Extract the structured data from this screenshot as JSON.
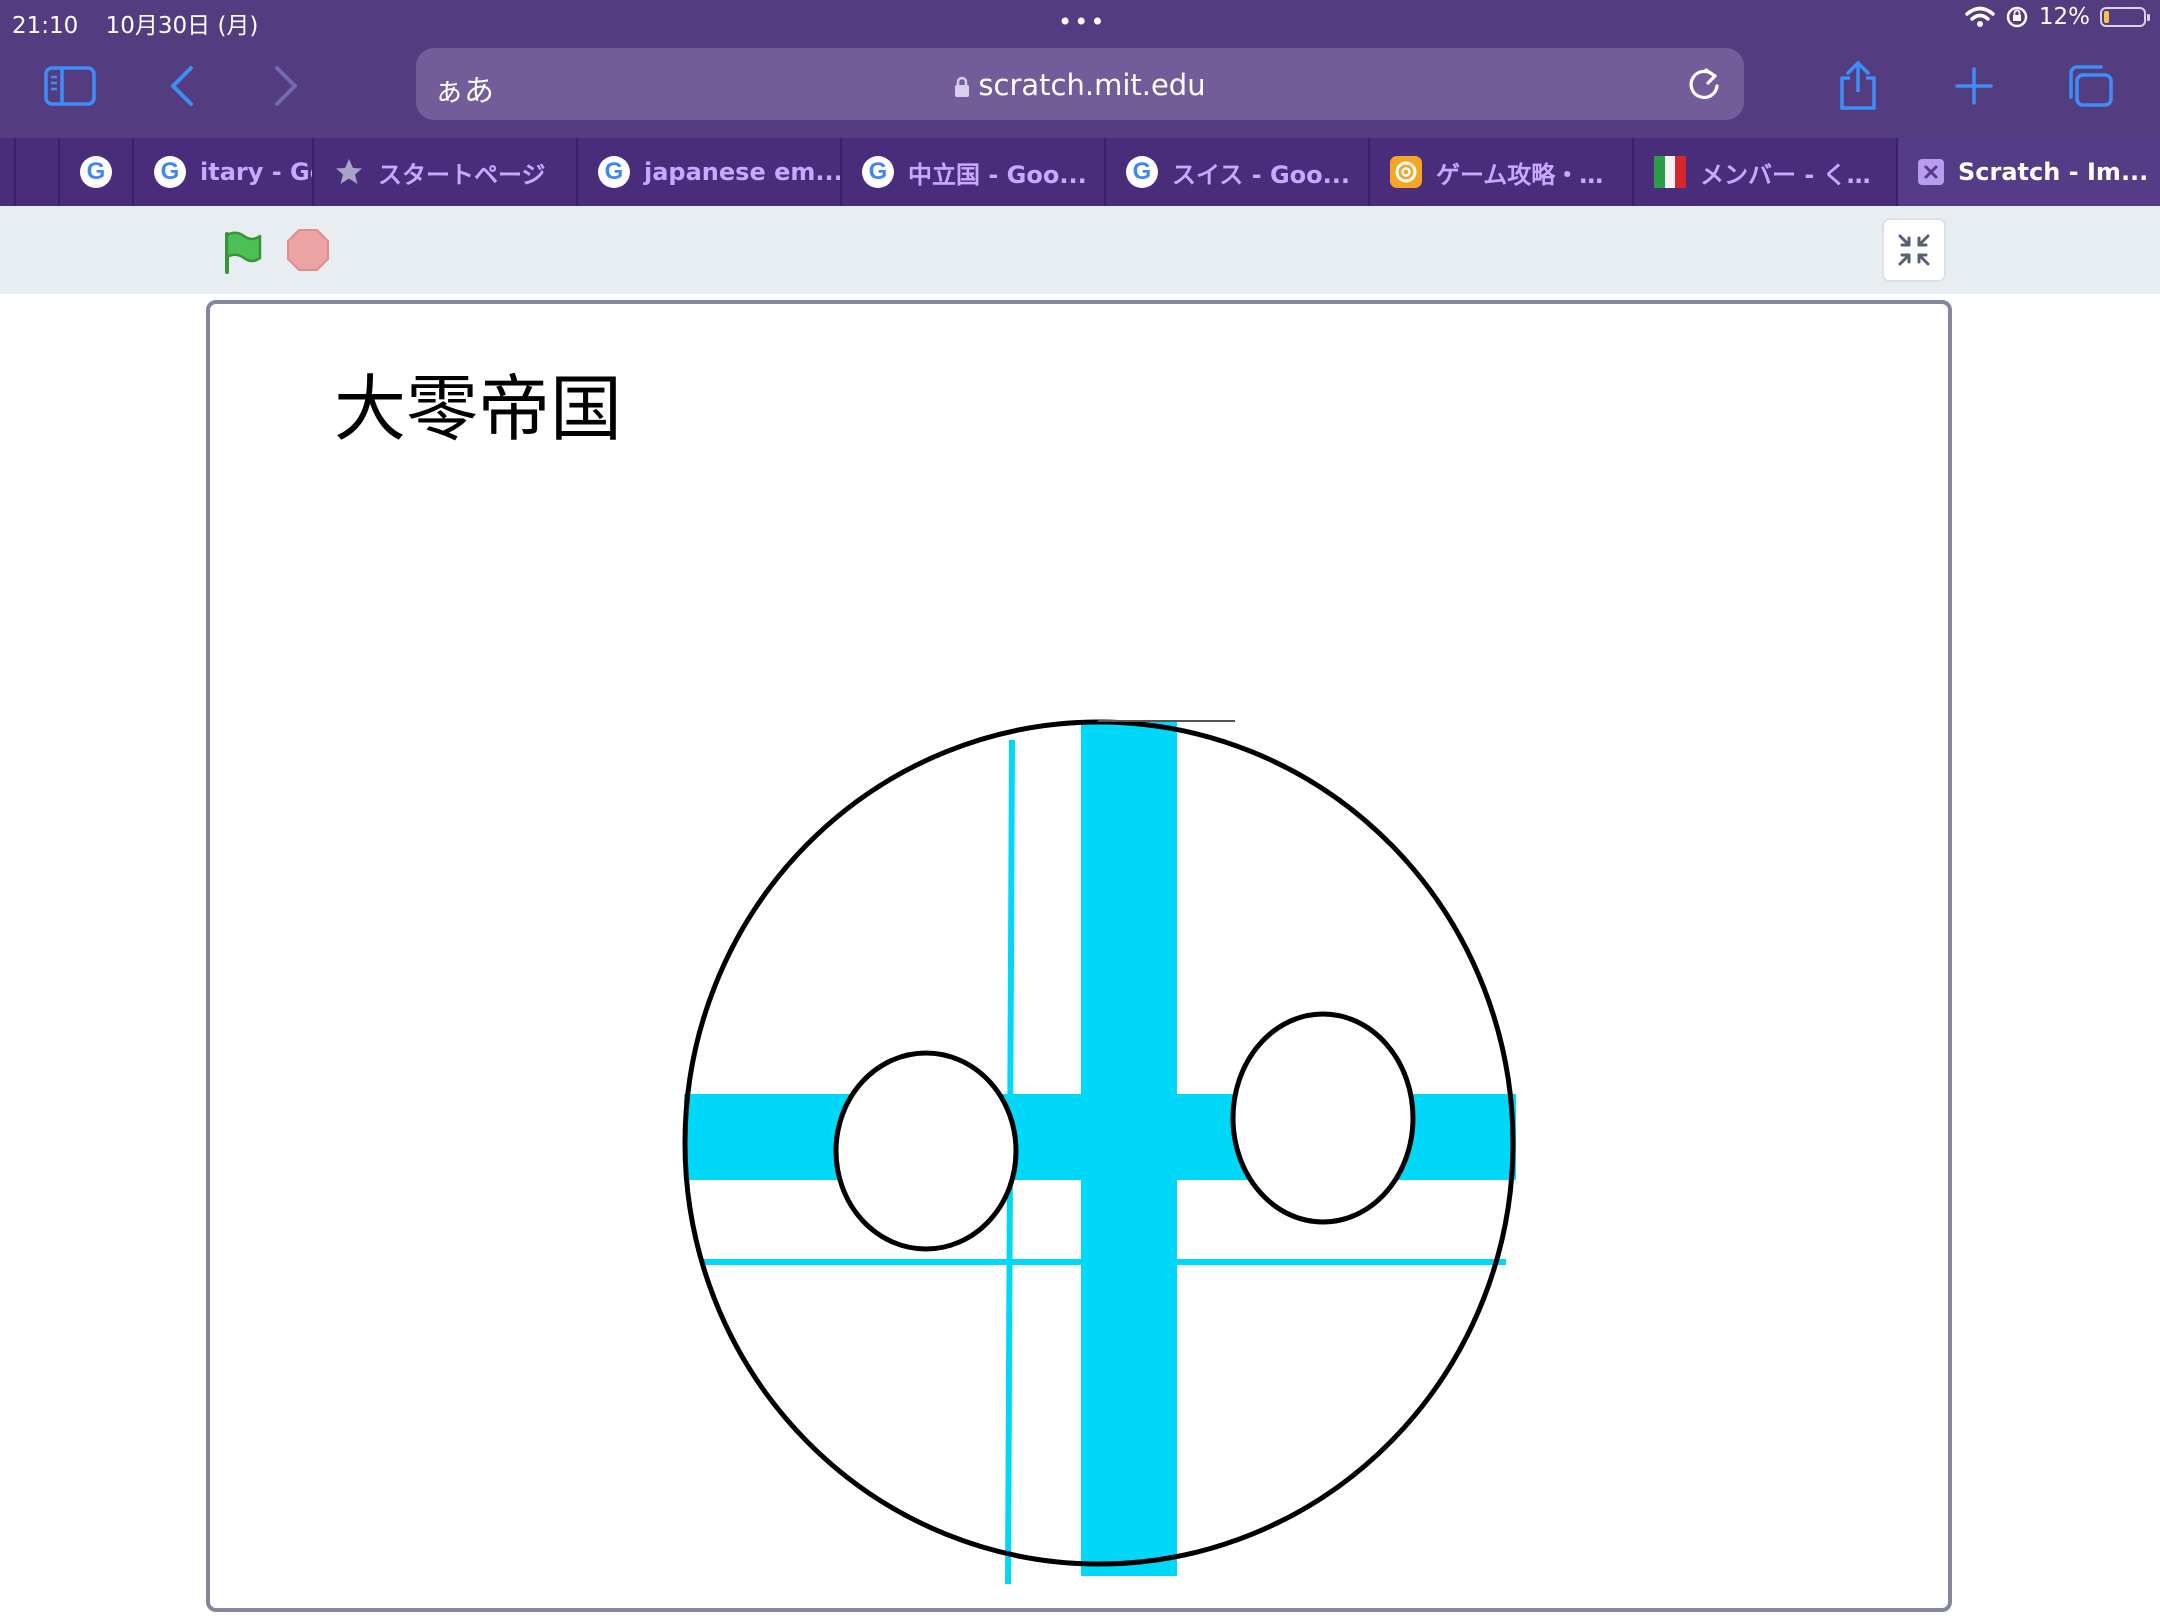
{
  "status_bar": {
    "time": "21:10",
    "date": "10月30日 (月)",
    "dots": "•••",
    "battery_text": "12%",
    "battery_level": 0.12,
    "icons": [
      "wifi-icon",
      "orientation-lock-icon",
      "battery-icon"
    ]
  },
  "toolbar": {
    "icons": [
      "sidebar-icon",
      "back-icon",
      "forward-icon",
      "share-icon",
      "new-tab-icon",
      "tabs-overview-icon"
    ]
  },
  "address_bar": {
    "reader_label": "ぁあ",
    "url": "scratch.mit.edu",
    "icons": [
      "lock-icon",
      "reload-icon"
    ]
  },
  "tabs": [
    {
      "label": "",
      "icon": "google-icon"
    },
    {
      "label": "itary - Gc",
      "icon": "google-icon"
    },
    {
      "label": "スタートページ",
      "icon": "star-icon"
    },
    {
      "label": "japanese em...",
      "icon": "google-icon"
    },
    {
      "label": "中立国 - Goo...",
      "icon": "google-icon"
    },
    {
      "label": "スイス - Goo...",
      "icon": "google-icon"
    },
    {
      "label": "ゲーム攻略・…",
      "icon": "at-sign-icon"
    },
    {
      "label": "メンバー - く…",
      "icon": "italy-flag-icon"
    },
    {
      "label": "Scratch - Im...",
      "icon": "scratch-icon",
      "active": true
    }
  ],
  "google_glyph": "G",
  "scratch_controls": {
    "icons": [
      "green-flag-icon",
      "stop-icon",
      "shrink-screen-icon"
    ]
  },
  "stage": {
    "title": "大零帝国",
    "emblem_colors": {
      "stroke": "#000000",
      "accent": "#00d8fa"
    }
  }
}
